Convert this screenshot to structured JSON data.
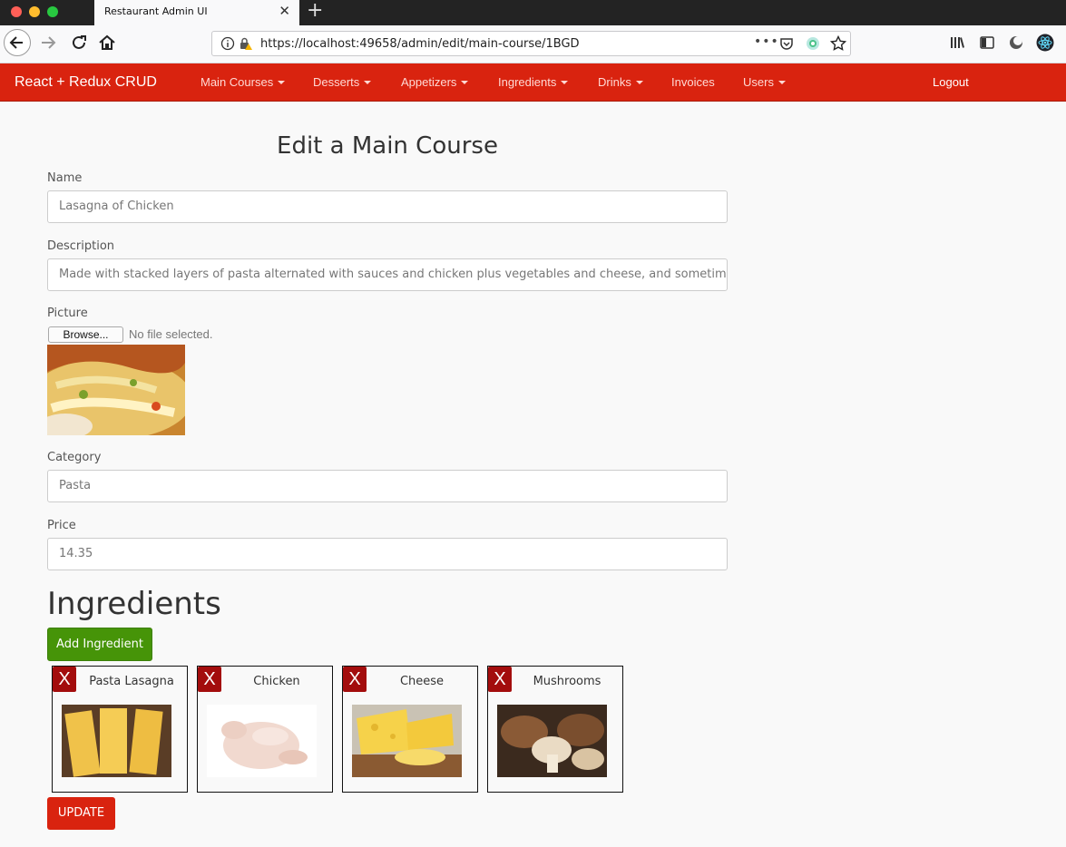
{
  "browser": {
    "tab_title": "Restaurant Admin UI",
    "tab_close": "✕",
    "new_tab": "+",
    "url": "https://localhost:49658/admin/edit/main-course/1BGD",
    "page_actions": "•••"
  },
  "navbar": {
    "brand": "React + Redux CRUD",
    "items": [
      {
        "label": "Main Courses",
        "dropdown": true
      },
      {
        "label": "Desserts",
        "dropdown": true
      },
      {
        "label": "Appetizers",
        "dropdown": true
      },
      {
        "label": "Ingredients",
        "dropdown": true
      },
      {
        "label": "Drinks",
        "dropdown": true
      },
      {
        "label": "Invoices",
        "dropdown": false
      },
      {
        "label": "Users",
        "dropdown": true
      }
    ],
    "logout": "Logout",
    "color": "#d9230f"
  },
  "form": {
    "title": "Edit a Main Course",
    "name_label": "Name",
    "name_value": "Lasagna of Chicken",
    "description_label": "Description",
    "description_value": "Made with stacked layers of pasta alternated with sauces and chicken plus vegetables and cheese, and sometimes topped",
    "picture_label": "Picture",
    "browse_label": "Browse...",
    "file_status": "No file selected.",
    "category_label": "Category",
    "category_value": "Pasta",
    "price_label": "Price",
    "price_value": "14.35"
  },
  "ingredients": {
    "heading": "Ingredients",
    "add_label": "Add Ingredient",
    "remove_label": "X",
    "items": [
      {
        "name": "Pasta Lasagna"
      },
      {
        "name": "Chicken"
      },
      {
        "name": "Cheese"
      },
      {
        "name": "Mushrooms"
      }
    ]
  },
  "update_label": "UPDATE",
  "colors": {
    "accent": "#d9230f",
    "success": "#469408",
    "remove": "#a30d0d"
  }
}
